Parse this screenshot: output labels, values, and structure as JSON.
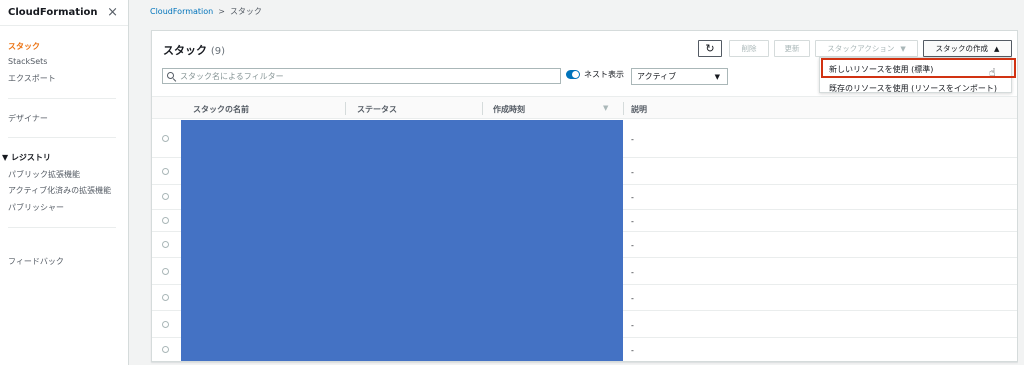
{
  "sidebar": {
    "title": "CloudFormation",
    "close_icon": "×",
    "items": {
      "stacks": "スタック",
      "stacksets": "StackSets",
      "exports": "エクスポート",
      "designer": "デザイナー",
      "registry": "▼ レジストリ",
      "public_ext": "パブリック拡張機能",
      "activated_ext": "アクティブ化済みの拡張機能",
      "publisher": "パブリッシャー",
      "feedback": "フィードバック"
    },
    "active_color": "#ec7211"
  },
  "breadcrumb": {
    "root": "CloudFormation",
    "separator": ">",
    "current": "スタック"
  },
  "panel": {
    "title": "スタック",
    "count": "(9)",
    "buttons": {
      "refresh": "↻",
      "delete": "削除",
      "update": "更新",
      "stack_actions": "スタックアクション",
      "stack_actions_caret": "▼",
      "create_stack": "スタックの作成",
      "create_caret": "▲"
    },
    "search": {
      "placeholder": "スタック名によるフィルター"
    },
    "nested_toggle_label": "ネスト表示",
    "status_select": {
      "value": "アクティブ",
      "arrow": "▼"
    }
  },
  "create_menu": {
    "items": [
      "新しいリソースを使用 (標準)",
      "既存のリソースを使用 (リソースをインポート)"
    ],
    "highlight_color": "#d13212"
  },
  "table": {
    "columns": [
      "スタックの名前",
      "ステータス",
      "作成時刻",
      "説明"
    ],
    "sort_icon": "▼",
    "rows": [
      {
        "description": "-"
      },
      {
        "description": "-"
      },
      {
        "description": "-"
      },
      {
        "description": "-"
      },
      {
        "description": "-"
      },
      {
        "description": "-"
      },
      {
        "description": "-"
      },
      {
        "description": "-"
      },
      {
        "description": "-"
      }
    ],
    "redaction_color": "#4472c4"
  }
}
